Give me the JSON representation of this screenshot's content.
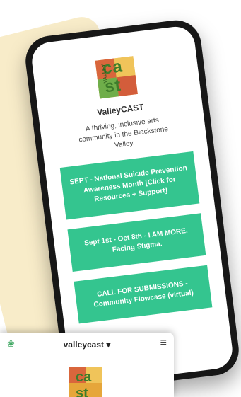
{
  "phone": {
    "site_title": "ValleyCAST",
    "tagline": "A thriving, inclusive arts community in the Blackstone Valley.",
    "buttons": [
      {
        "label": "SEPT - National Suicide Prevention Awareness Month [Click for Resources + Support]"
      },
      {
        "label": "Sept 1st - Oct 8th - I AM MORE. Facing Stigma."
      },
      {
        "label": "CALL FOR SUBMISSIONS - Community Flowcase (virtual)"
      }
    ]
  },
  "mini_header": {
    "site_name": "valleycast ▾",
    "menu_icon_glyph": "≡",
    "flower_icon_glyph": "❀"
  },
  "logo": {
    "letters": "ca st",
    "side_text": "VALLEY"
  },
  "colors": {
    "accent_green": "#34c58f",
    "cream": "#f8ecc9",
    "phone_body": "#171717"
  }
}
